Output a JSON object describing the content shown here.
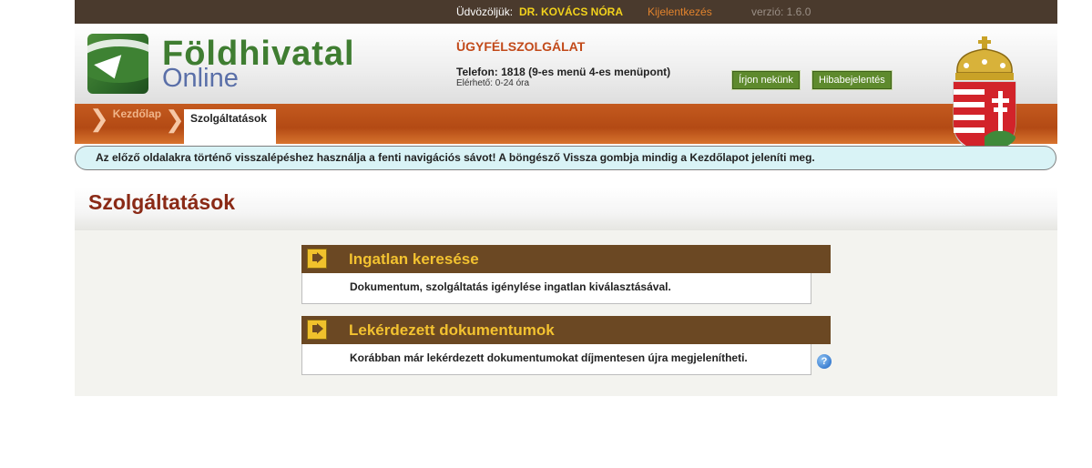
{
  "topbar": {
    "welcome": "Üdvözöljük:",
    "user": "DR. KOVÁCS NÓRA",
    "logout": "Kijelentkezés",
    "version": "verzió: 1.6.0"
  },
  "logo": {
    "line1": "Földhivatal",
    "line2": "Online"
  },
  "customer_service": {
    "title": "ÜGYFÉLSZOLGÁLAT",
    "phone": "Telefon: 1818 (9-es menü 4-es menüpont)",
    "availability": "Elérhető: 0-24 óra"
  },
  "header_buttons": {
    "write_us": "Írjon nekünk",
    "bug_report": "Hibabejelentés"
  },
  "breadcrumb": {
    "home": "Kezdőlap",
    "current": "Szolgáltatások"
  },
  "notice": "Az előző oldalakra történő visszalépéshez használja a fenti navigációs sávot! A böngésző Vissza gombja mindig a Kezdőlapot jeleníti meg.",
  "page_title": "Szolgáltatások",
  "services": [
    {
      "title": "Ingatlan keresése",
      "description": "Dokumentum, szolgáltatás igénylése ingatlan kiválasztásával."
    },
    {
      "title": "Lekérdezett dokumentumok",
      "description": "Korábban már lekérdezett dokumentumokat díjmentesen újra megjelenítheti."
    }
  ],
  "icons": {
    "service_arrow": "arrow-right-icon",
    "help": "help-icon",
    "coat_of_arms": "coat-of-arms-icon"
  },
  "colors": {
    "topbar": "#4a3a2d",
    "nav": "#c45a1f",
    "service_header": "#6b4823",
    "service_title": "#f3c230",
    "page_title": "#8a2a16"
  }
}
